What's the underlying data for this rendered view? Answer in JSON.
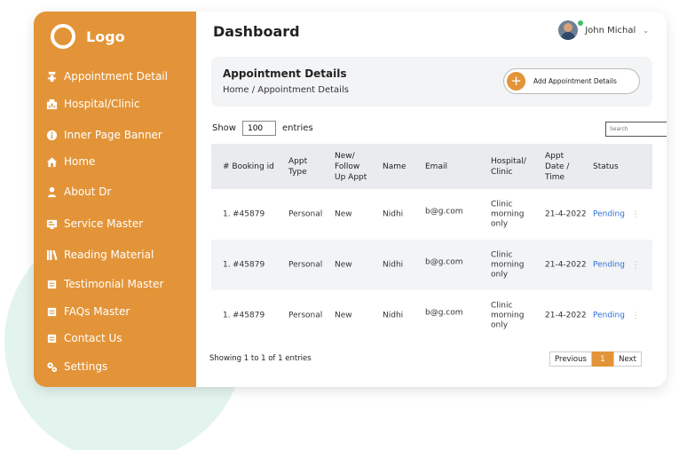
{
  "brand": {
    "logo_text": "Logo"
  },
  "sidebar": {
    "items": [
      {
        "label": "Appointment Detail",
        "icon": "hospital-bed-icon"
      },
      {
        "label": "Hospital/Clinic",
        "icon": "hospital-building-icon"
      },
      {
        "label": "Inner Page Banner",
        "icon": "info-icon"
      },
      {
        "label": "Home",
        "icon": "home-icon"
      },
      {
        "label": "About Dr",
        "icon": "user-icon"
      },
      {
        "label": "Service Master",
        "icon": "service-icon"
      },
      {
        "label": "Reading Material",
        "icon": "books-icon"
      },
      {
        "label": "Testimonial Master",
        "icon": "document-icon"
      },
      {
        "label": "FAQs Master",
        "icon": "document-icon"
      },
      {
        "label": "Contact Us",
        "icon": "document-icon"
      },
      {
        "label": "Settings",
        "icon": "gears-icon"
      }
    ]
  },
  "header": {
    "title": "Dashboard",
    "user_name": "John Michal"
  },
  "panel": {
    "title": "Appointment Details",
    "breadcrumb": "Home / Appointment Details",
    "add_button": "Add Appointment Details"
  },
  "table_controls": {
    "show_label": "Show",
    "entries_value": "100",
    "entries_label": "entries",
    "search_placeholder": "Search"
  },
  "table": {
    "headers": [
      "# Booking id",
      "Appt\nType",
      "New/\nFollow\nUp Appt",
      "Name",
      "Email",
      "Hospital/\nClinic",
      "Appt\nDate /\nTime",
      "Status"
    ],
    "rows": [
      {
        "num": "1.",
        "booking_id": "#45879",
        "type": "Personal",
        "follow": "New",
        "name": "Nidhi",
        "email": "b@g.com",
        "clinic": "Clinic\nmorning\nonly",
        "date": "21-4-2022",
        "status": "Pending"
      },
      {
        "num": "1.",
        "booking_id": "#45879",
        "type": "Personal",
        "follow": "New",
        "name": "Nidhi",
        "email": "b@g.com",
        "clinic": "Clinic\nmorning\nonly",
        "date": "21-4-2022",
        "status": "Pending"
      },
      {
        "num": "1.",
        "booking_id": "#45879",
        "type": "Personal",
        "follow": "New",
        "name": "Nidhi",
        "email": "b@g.com",
        "clinic": "Clinic\nmorning\nonly",
        "date": "21-4-2022",
        "status": "Pending"
      }
    ]
  },
  "footer": {
    "showing": "Showing 1 to 1 of 1 entries",
    "prev": "Previous",
    "current_page": "1",
    "next": "Next"
  },
  "colors": {
    "accent": "#e39438",
    "status": "#2e6fd8",
    "panel_bg": "#f3f4f6",
    "bg_circle": "#e3f4ef"
  }
}
